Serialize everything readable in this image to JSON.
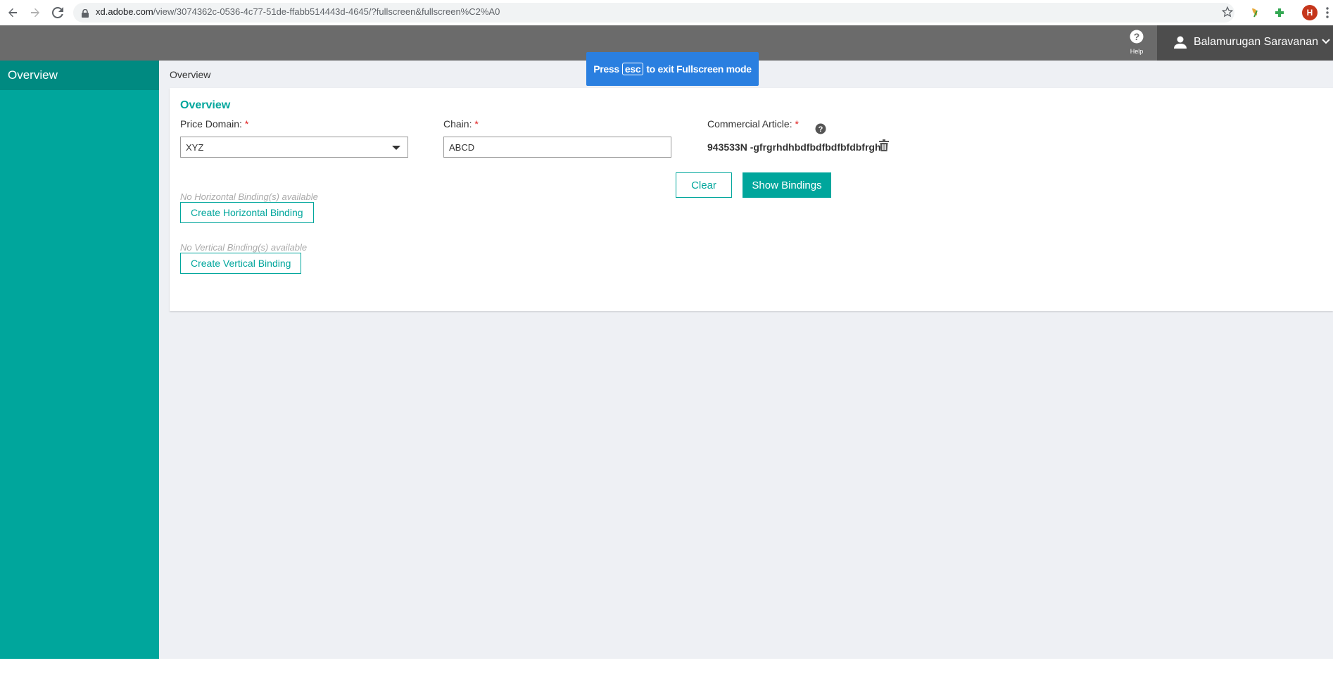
{
  "browser": {
    "url_host": "xd.adobe.com",
    "url_path": "/view/3074362c-0536-4c77-51de-ffabb514443d-4645/?fullscreen&fullscreen%C2%A0",
    "profile_initial": "H"
  },
  "header": {
    "help_label": "Help",
    "user_name": "Balamurugan Saravanan"
  },
  "sidebar": {
    "items": [
      {
        "label": "Overview",
        "active": true
      }
    ]
  },
  "main": {
    "breadcrumb": "Overview",
    "card_title": "Overview",
    "price_domain": {
      "label": "Price Domain:",
      "required_mark": "*",
      "value": "XYZ"
    },
    "chain": {
      "label": "Chain:",
      "required_mark": "*",
      "value": "ABCD"
    },
    "commercial_article": {
      "label": "Commercial Article:",
      "required_mark": "*",
      "value": "943533N -gfrgrhdhbdfbdfbdfbfdbfrgh"
    },
    "clear_label": "Clear",
    "show_bindings_label": "Show Bindings",
    "horizontal": {
      "empty_note": "No Horizontal Binding(s) available",
      "create_label": "Create Horizontal Binding"
    },
    "vertical": {
      "empty_note": "No Vertical Binding(s) available",
      "create_label": "Create Vertical Binding"
    }
  },
  "toast": {
    "prefix": "Press",
    "key": "esc",
    "suffix": "to exit Fullscreen mode"
  },
  "colors": {
    "accent": "#00a69c",
    "accent_dark": "#008a81",
    "header_bg": "#6b6b6b",
    "toast_bg": "#2a7fe0",
    "required": "#e02020"
  }
}
